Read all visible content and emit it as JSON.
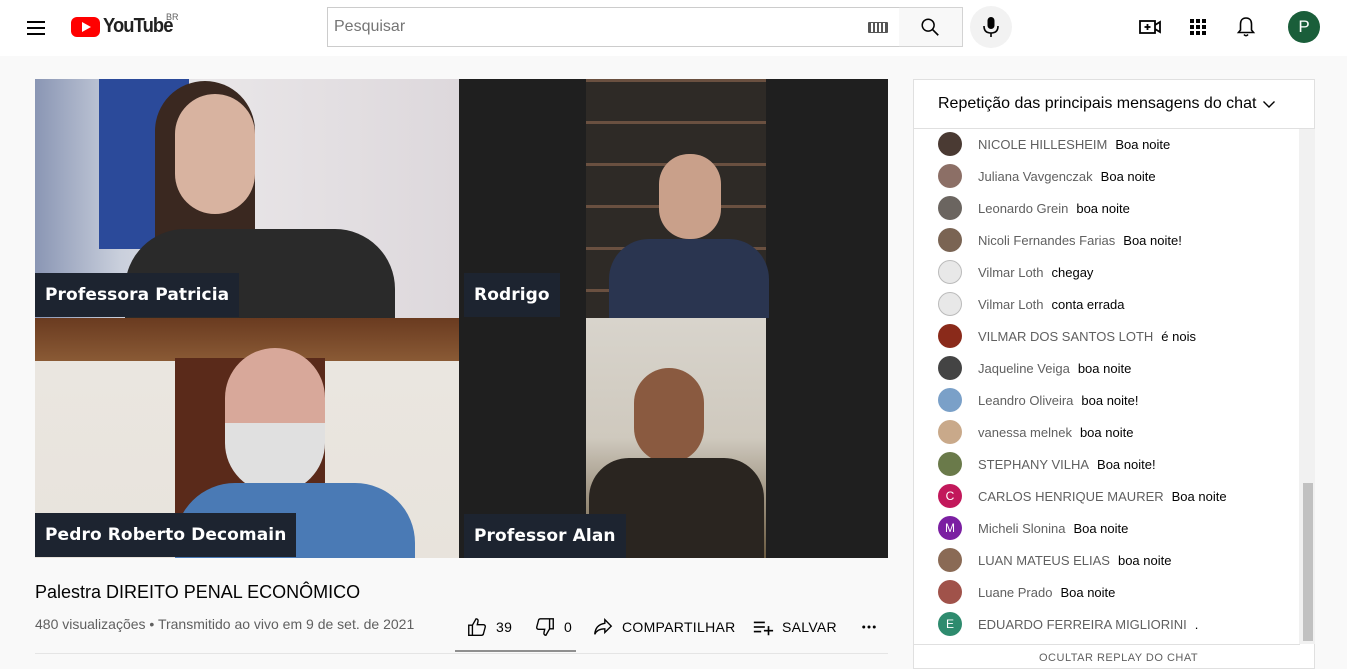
{
  "header": {
    "logo_text": "YouTube",
    "country": "BR",
    "search_placeholder": "Pesquisar",
    "avatar_letter": "P",
    "icons": [
      "menu-icon",
      "keyboard-icon",
      "search-icon",
      "mic-icon",
      "create-video-icon",
      "apps-icon",
      "notifications-icon"
    ]
  },
  "video": {
    "participants": [
      {
        "name": "Professora Patricia"
      },
      {
        "name": "Rodrigo"
      },
      {
        "name": "Pedro Roberto Decomain"
      },
      {
        "name": "Professor Alan"
      }
    ],
    "title": "Palestra DIREITO PENAL ECONÔMICO",
    "meta": "480 visualizações • Transmitido ao vivo em 9 de set. de 2021",
    "likes": "39",
    "dislikes": "0",
    "share_label": "COMPARTILHAR",
    "save_label": "SALVAR"
  },
  "chat": {
    "header": "Repetição das principais mensagens do chat",
    "messages": [
      {
        "author": "NICOLE HILLESHEIM",
        "text": "Boa noite",
        "color": "#4a3a33"
      },
      {
        "author": "Juliana Vavgenczak",
        "text": "Boa noite",
        "color": "#8c6f66"
      },
      {
        "author": "Leonardo Grein",
        "text": "boa noite",
        "color": "#6b6560"
      },
      {
        "author": "Nicoli Fernandes Farias",
        "text": "Boa noite!",
        "color": "#7a6453"
      },
      {
        "author": "Vilmar Loth",
        "text": "chegay",
        "color": "#e8e8e8"
      },
      {
        "author": "Vilmar Loth",
        "text": "conta errada",
        "color": "#e8e8e8"
      },
      {
        "author": "VILMAR DOS SANTOS LOTH",
        "text": "é nois",
        "color": "#8a2a1a"
      },
      {
        "author": "Jaqueline Veiga",
        "text": "boa noite",
        "color": "#444444"
      },
      {
        "author": "Leandro Oliveira",
        "text": "boa noite!",
        "color": "#7aa0c8"
      },
      {
        "author": "vanessa melnek",
        "text": "boa noite",
        "color": "#c9a98a"
      },
      {
        "author": "STEPHANY VILHA",
        "text": "Boa noite!",
        "color": "#6a7a4a"
      },
      {
        "author": "CARLOS HENRIQUE MAURER",
        "text": "Boa noite",
        "color": "#c2185b",
        "letter": "C"
      },
      {
        "author": "Micheli Slonina",
        "text": "Boa noite",
        "color": "#7b1fa2",
        "letter": "M"
      },
      {
        "author": "LUAN MATEUS ELIAS",
        "text": "boa noite",
        "color": "#8a6a55"
      },
      {
        "author": "Luane Prado",
        "text": "Boa noite",
        "color": "#a0524a"
      },
      {
        "author": "EDUARDO FERREIRA MIGLIORINI",
        "text": ".",
        "color": "#2e8b6e",
        "letter": "E"
      }
    ],
    "footer": "OCULTAR REPLAY DO CHAT"
  }
}
